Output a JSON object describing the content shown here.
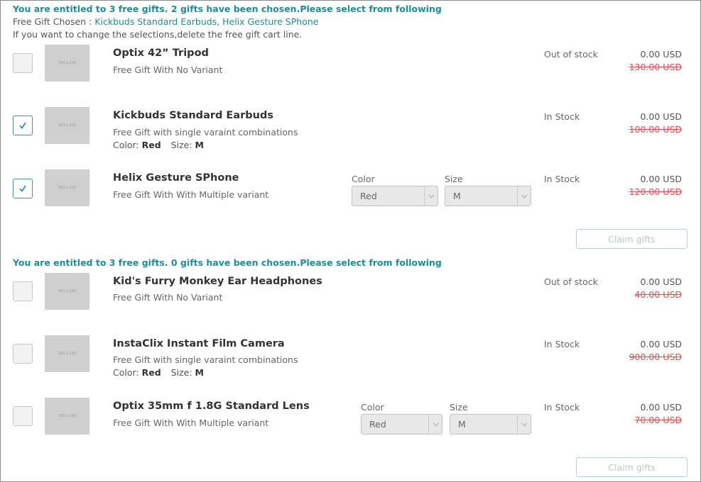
{
  "sections": [
    {
      "title": "You are entitled to 3 free gifts. 2 gifts have been chosen.Please select from following",
      "chosen_label": "Free Gift Chosen : ",
      "chosen_links": "Kickbuds Standard Earbuds, Helix Gesture SPhone",
      "change_note": "If you want to change the selections,delete the free gift cart line.",
      "claim_label": "Claim gifts",
      "products": [
        {
          "name": "Optix 42” Tripod",
          "desc": "Free Gift With No Variant",
          "stock": "Out of stock",
          "price": "0.00 USD",
          "old_price": "130.00 USD",
          "checked": false
        },
        {
          "name": "Kickbuds Standard Earbuds",
          "desc": "Free Gift with single varaint combinations",
          "color_label": "Color:",
          "color": "Red",
          "size_label": "Size:",
          "size": "M",
          "stock": "In Stock",
          "price": "0.00 USD",
          "old_price": "100.00 USD",
          "checked": true
        },
        {
          "name": "Helix Gesture SPhone",
          "desc": "Free Gift With With Multiple variant",
          "color_field_label": "Color",
          "color_value": "Red",
          "size_field_label": "Size",
          "size_value": "M",
          "stock": "In Stock",
          "price": "0.00 USD",
          "old_price": "120.00 USD",
          "checked": true
        }
      ]
    },
    {
      "title": "You are entitled to 3 free gifts. 0 gifts have been chosen.Please select from following",
      "claim_label": "Claim gifts",
      "products": [
        {
          "name": "Kid's Furry Monkey Ear Headphones",
          "desc": "Free Gift With No Variant",
          "stock": "Out of stock",
          "price": "0.00 USD",
          "old_price": "40.00 USD",
          "checked": false
        },
        {
          "name": "InstaClix Instant Film Camera",
          "desc": "Free Gift with single varaint combinations",
          "color_label": "Color:",
          "color": "Red",
          "size_label": "Size:",
          "size": "M",
          "stock": "In Stock",
          "price": "0.00 USD",
          "old_price": "900.00 USD",
          "checked": false
        },
        {
          "name": "Optix 35mm f 1.8G Standard Lens",
          "desc": "Free Gift With With Multiple variant",
          "color_field_label": "Color",
          "color_value": "Red",
          "size_field_label": "Size",
          "size_value": "M",
          "stock": "In Stock",
          "price": "0.00 USD",
          "old_price": "70.00 USD",
          "checked": false
        }
      ]
    }
  ],
  "thumbnail_text": "263 x 220",
  "colors": {
    "accent": "#1d8c99",
    "strike": "#d9534f",
    "thumb": "#cfcfcf"
  },
  "icons": {
    "check": "checkmark-icon",
    "select_arrow": "chevron-down-icon"
  }
}
